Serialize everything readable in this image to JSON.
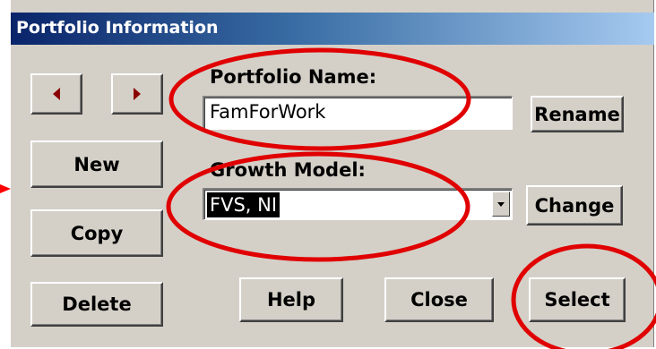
{
  "window": {
    "title": "Portfolio Information"
  },
  "nav": {
    "prev_icon": "left-triangle",
    "next_icon": "right-triangle"
  },
  "buttons": {
    "new": "New",
    "copy": "Copy",
    "delete": "Delete",
    "rename": "Rename",
    "change": "Change",
    "help": "Help",
    "close": "Close",
    "select": "Select"
  },
  "portfolio": {
    "label": "Portfolio Name:",
    "value": "FamForWork"
  },
  "growth_model": {
    "label": "Growth Model:",
    "value": "FVS, NI"
  },
  "annotations": {
    "highlight_color": "#e00000"
  }
}
